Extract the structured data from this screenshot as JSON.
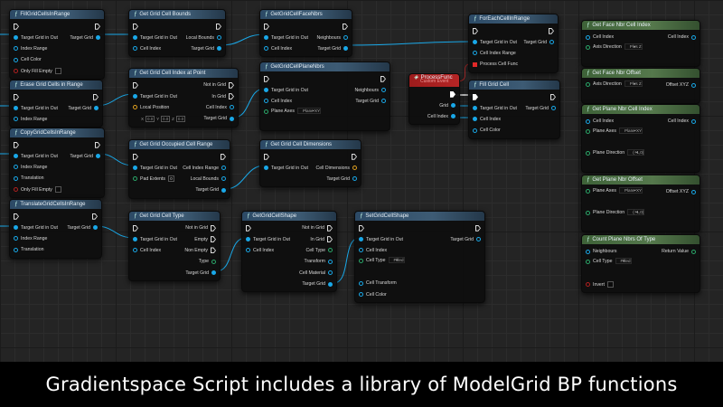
{
  "caption": "Gradientspace Script includes a library of ModelGrid BP functions",
  "colors": {
    "function_header": "#3d5b74",
    "pure_header": "#55784c",
    "event_header": "#b52525",
    "struct_pin": "#19a8e8",
    "enum_pin": "#2aa86a",
    "vector_pin": "#e0a020",
    "bool_pin": "#b02020"
  },
  "nodes": [
    {
      "title": "FillGridCellsInRange",
      "kind": "function",
      "rows": [
        {
          "lp": "exec",
          "rp": "exec"
        },
        {
          "l": "Target Grid in Out",
          "lp": "blue-filled",
          "r": "Target Grid",
          "rp": "blue-filled"
        },
        {
          "l": "Index Range",
          "lp": "blue-hollow"
        },
        {
          "l": "Cell Color",
          "lp": "blue-hollow"
        },
        {
          "l": "Only Fill Empty",
          "lp": "red-hollow",
          "check": false
        }
      ]
    },
    {
      "title": "Erase Grid Cells in Range",
      "kind": "function",
      "rows": [
        {
          "lp": "exec",
          "rp": "exec"
        },
        {
          "l": "Target Grid in Out",
          "lp": "blue-filled",
          "r": "Target Grid",
          "rp": "blue-filled"
        },
        {
          "l": "Index Range",
          "lp": "blue-hollow"
        }
      ]
    },
    {
      "title": "CopyGridCellsInRange",
      "kind": "function",
      "rows": [
        {
          "lp": "exec",
          "rp": "exec"
        },
        {
          "l": "Target Grid in Out",
          "lp": "blue-filled",
          "r": "Target Grid",
          "rp": "blue-filled"
        },
        {
          "l": "Index Range",
          "lp": "blue-hollow"
        },
        {
          "l": "Translation",
          "lp": "blue-hollow"
        },
        {
          "l": "Only Fill Empty",
          "lp": "red-hollow",
          "check": false
        }
      ]
    },
    {
      "title": "TranslateGridCellsInRange",
      "kind": "function",
      "rows": [
        {
          "lp": "exec",
          "rp": "exec"
        },
        {
          "l": "Target Grid in Out",
          "lp": "blue-filled",
          "r": "Target Grid",
          "rp": "blue-filled"
        },
        {
          "l": "Index Range",
          "lp": "blue-hollow"
        },
        {
          "l": "Translation",
          "lp": "blue-hollow"
        }
      ]
    },
    {
      "title": "Get Grid Cell Bounds",
      "kind": "function",
      "rows": [
        {
          "lp": "exec",
          "rp": "exec"
        },
        {
          "l": "Target Grid in Out",
          "lp": "blue-filled",
          "r": "Local Bounds",
          "rp": "blue-hollow"
        },
        {
          "l": "Cell Index",
          "lp": "blue-hollow",
          "r": "Target Grid",
          "rp": "blue-filled"
        }
      ]
    },
    {
      "title": "Get Grid Cell Index at Point",
      "kind": "function",
      "rows": [
        {
          "lp": "exec",
          "r": "Not in Grid",
          "rp": "exec"
        },
        {
          "l": "Target Grid in Out",
          "lp": "blue-filled",
          "r": "In Grid",
          "rp": "exec"
        },
        {
          "l": "Local Position",
          "lp": "orange-hollow",
          "r": "Cell Index",
          "rp": "blue-hollow"
        },
        {
          "vec": [
            [
              "X",
              "0.0"
            ],
            [
              "Y",
              "0.0"
            ],
            [
              "Z",
              "0.0"
            ]
          ],
          "r": "Target Grid",
          "rp": "blue-filled"
        }
      ]
    },
    {
      "title": "Get Grid Occupied Cell Range",
      "kind": "function",
      "rows": [
        {
          "lp": "exec",
          "rp": "exec"
        },
        {
          "l": "Target Grid in Out",
          "lp": "blue-filled",
          "r": "Cell Index Range",
          "rp": "blue-hollow"
        },
        {
          "l": "Pad Extents",
          "lp": "green-hollow",
          "box": "0",
          "r": "Local Bounds",
          "rp": "blue-hollow"
        },
        {
          "r": "Target Grid",
          "rp": "blue-filled"
        }
      ]
    },
    {
      "title": "Get Grid Cell Type",
      "kind": "function",
      "rows": [
        {
          "lp": "exec",
          "r": "Not in Grid",
          "rp": "exec"
        },
        {
          "l": "Target Grid in Out",
          "lp": "blue-filled",
          "r": "Empty",
          "rp": "exec"
        },
        {
          "l": "Cell Index",
          "lp": "blue-hollow",
          "r": "Non Empty",
          "rp": "exec"
        },
        {
          "r": "Type",
          "rp": "green-hollow"
        },
        {
          "r": "Target Grid",
          "rp": "blue-filled"
        }
      ]
    },
    {
      "title": "GetGridCellFaceNbrs",
      "kind": "function",
      "rows": [
        {
          "lp": "exec",
          "rp": "exec"
        },
        {
          "l": "Target Grid in Out",
          "lp": "blue-filled",
          "r": "Neighbours",
          "rp": "blue-hollow"
        },
        {
          "l": "Cell Index",
          "lp": "blue-hollow",
          "r": "Target Grid",
          "rp": "blue-filled"
        }
      ]
    },
    {
      "title": "GetGridCellPlaneNbrs",
      "kind": "function",
      "rows": [
        {
          "lp": "exec",
          "rp": "exec"
        },
        {
          "l": "Target Grid in Out",
          "lp": "blue-filled",
          "r": "Neighbours",
          "rp": "blue-hollow"
        },
        {
          "l": "Cell Index",
          "lp": "blue-hollow",
          "r": "Target Grid",
          "rp": "blue-hollow"
        },
        {
          "ddl": "Plane Axes",
          "lp": "green-hollow",
          "dd": "Plane XY"
        }
      ]
    },
    {
      "title": "Get Grid Cell Dimensions",
      "kind": "function",
      "rows": [
        {
          "lp": "exec",
          "rp": "exec"
        },
        {
          "l": "Target Grid in Out",
          "lp": "blue-filled",
          "r": "Cell Dimensions",
          "rp": "orange-hollow"
        },
        {
          "r": "Target Grid",
          "rp": "blue-hollow"
        }
      ]
    },
    {
      "title": "GetGridCellShape",
      "kind": "function",
      "rows": [
        {
          "lp": "exec",
          "r": "Not in Grid",
          "rp": "exec"
        },
        {
          "l": "Target Grid in Out",
          "lp": "blue-filled",
          "r": "In Grid",
          "rp": "exec"
        },
        {
          "l": "Cell Index",
          "lp": "blue-hollow",
          "r": "Cell Type",
          "rp": "green-hollow"
        },
        {
          "r": "Transform",
          "rp": "blue-hollow"
        },
        {
          "r": "Cell Material",
          "rp": "blue-hollow"
        },
        {
          "r": "Target Grid",
          "rp": "blue-filled"
        }
      ]
    },
    {
      "title": "SetGridCellShape",
      "kind": "function",
      "rows": [
        {
          "lp": "exec",
          "rp": "exec"
        },
        {
          "l": "Target Grid in Out",
          "lp": "blue-filled",
          "r": "Target Grid",
          "rp": "blue-hollow"
        },
        {
          "l": "Cell Index",
          "lp": "blue-hollow"
        },
        {
          "ddl": "Cell Type",
          "lp": "green-hollow",
          "dd": "Filled"
        },
        {
          "l": "Cell Transform",
          "lp": "blue-hollow"
        },
        {
          "l": "Cell Color",
          "lp": "blue-hollow"
        }
      ]
    },
    {
      "title": "ProcessFunc",
      "subtitle": "Custom Event",
      "kind": "event",
      "rows": [
        {
          "rp": "exec-filled"
        },
        {
          "r": "Grid",
          "rp": "blue-filled"
        },
        {
          "r": "Cell Index",
          "rp": "blue-filled"
        }
      ]
    },
    {
      "title": "ForEachCellInRange",
      "kind": "function",
      "rows": [
        {
          "lp": "exec",
          "rp": "exec"
        },
        {
          "l": "Target Grid in Out",
          "lp": "blue-filled",
          "r": "Target Grid",
          "rp": "blue-hollow"
        },
        {
          "l": "Cell Index Range",
          "lp": "blue-hollow"
        },
        {
          "l": "Process Cell Func",
          "lp": "red-square"
        }
      ]
    },
    {
      "title": "Fill Grid Cell",
      "kind": "function",
      "rows": [
        {
          "lp": "exec-filled",
          "rp": "exec"
        },
        {
          "l": "Target Grid in Out",
          "lp": "blue-filled",
          "r": "Target Grid",
          "rp": "blue-hollow"
        },
        {
          "l": "Cell Index",
          "lp": "blue-filled"
        },
        {
          "l": "Cell Color",
          "lp": "blue-hollow"
        }
      ]
    },
    {
      "title": "Get Face Nbr Cell Index",
      "kind": "pure",
      "rows": [
        {
          "l": "Cell Index",
          "lp": "blue-hollow",
          "r": "Cell Index",
          "rp": "blue-hollow"
        },
        {
          "ddl": "Axis Direction",
          "lp": "green-hollow",
          "dd": "Plus Z"
        }
      ]
    },
    {
      "title": "Get Face Nbr Offset",
      "kind": "pure",
      "rows": [
        {
          "ddl": "Axis Direction",
          "lp": "green-hollow",
          "dd": "Plus Z",
          "r": "Offset XYZ",
          "rp": "blue-hollow"
        }
      ]
    },
    {
      "title": "Get Plane Nbr Cell Index",
      "kind": "pure",
      "rows": [
        {
          "l": "Cell Index",
          "lp": "blue-hollow",
          "r": "Cell Index",
          "rp": "blue-hollow"
        },
        {
          "ddl": "Plane Axes",
          "lp": "green-hollow",
          "dd": "Plane XY"
        },
        {
          "ddl": "Plane Direction",
          "lp": "green-hollow",
          "dd": "(+1,0)"
        }
      ]
    },
    {
      "title": "Get Plane Nbr Offset",
      "kind": "pure",
      "rows": [
        {
          "ddl": "Plane Axes",
          "lp": "green-hollow",
          "dd": "Plane XY",
          "r": "Offset XYZ",
          "rp": "blue-hollow"
        },
        {
          "ddl": "Plane Direction",
          "lp": "green-hollow",
          "dd": "(+1,0)"
        }
      ]
    },
    {
      "title": "Count Plane Nbrs Of Type",
      "kind": "pure",
      "rows": [
        {
          "l": "Neighbours",
          "lp": "blue-hollow",
          "r": "Return Value",
          "rp": "green-hollow"
        },
        {
          "ddl": "Cell Type",
          "lp": "green-hollow",
          "dd": "Filled"
        },
        {
          "l": "Invert",
          "lp": "red-hollow",
          "check": false
        }
      ]
    }
  ]
}
